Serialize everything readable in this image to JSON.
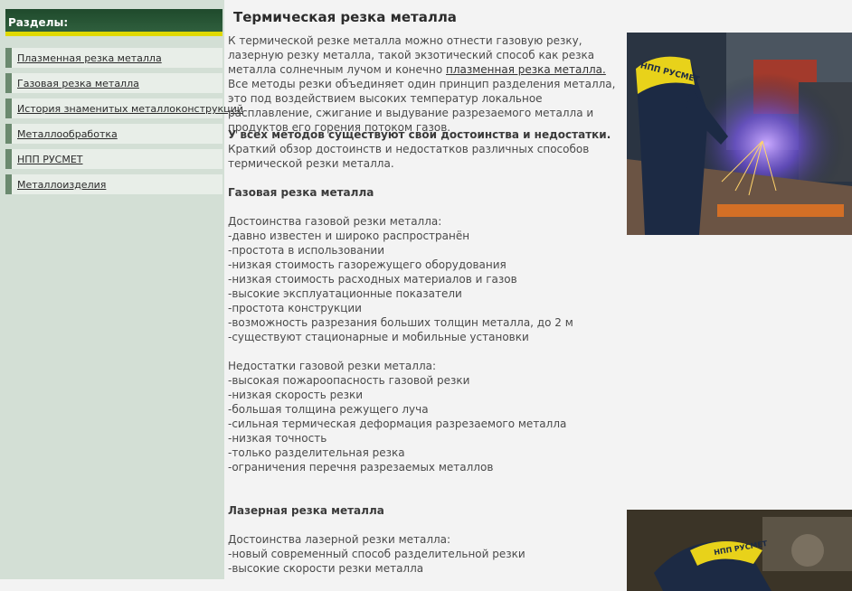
{
  "sidebar": {
    "header": "Разделы:",
    "items": [
      {
        "label": "Плазменная резка металла"
      },
      {
        "label": "Газовая резка металла"
      },
      {
        "label": "История знаменитых металлоконструкций"
      },
      {
        "label": "Металлообработка"
      },
      {
        "label": "НПП РУСМЕТ"
      },
      {
        "label": "Металлоизделия"
      }
    ]
  },
  "article": {
    "title": "Термическая резка металла",
    "intro_before_link": "К термической резке металла можно отнести газовую резку, лазерную резку металла, такой экзотический способ как резка металла солнечным лучом и конечно ",
    "intro_link": "плазменная резка металла.",
    "intro_after_link": " Все методы резки объединяет один принцип разделения металла, это под воздействием высоких температур локальное расплавление, сжигание и выдувание разрезаемого металла и продуктов его горения потоком газов.",
    "methods_heading": "У всех методов существуют свои достоинства и недостатки.",
    "methods_text": "Краткий обзор достоинств и недостатков различных способов термической резки металла.",
    "gas_heading": "Газовая резка металла",
    "gas_pros_heading": "Достоинства газовой резки металла:",
    "gas_pros": [
      "-давно известен и широко распространён",
      "-простота в использовании",
      "-низкая стоимость газорежущего оборудования",
      "-низкая стоимость расходных материалов и газов",
      "-высокие эксплуатационные показатели",
      "-простота конструкции",
      "-возможность разрезания больших толщин металла, до 2 м",
      "-существуют стационарные и мобильные установки"
    ],
    "gas_cons_heading": "Недостатки газовой резки металла:",
    "gas_cons": [
      "-высокая пожароопасность газовой резки",
      "-низкая скорость резки",
      "-большая толщина режущего луча",
      "-сильная термическая деформация разрезаемого металла",
      "-низкая точность",
      "-только разделительная резка",
      "-ограничения перечня разрезаемых металлов"
    ],
    "laser_heading": "Лазерная резка металла",
    "laser_pros_heading": "Достоинства лазерной резки металла:",
    "laser_pros": [
      "-новый современный способ разделительной резки",
      "-высокие скорости резки металла"
    ]
  },
  "images": {
    "photo1_logo": "НПП РУСМЕТ",
    "photo2_logo": "НПП РУСМЕТ"
  }
}
